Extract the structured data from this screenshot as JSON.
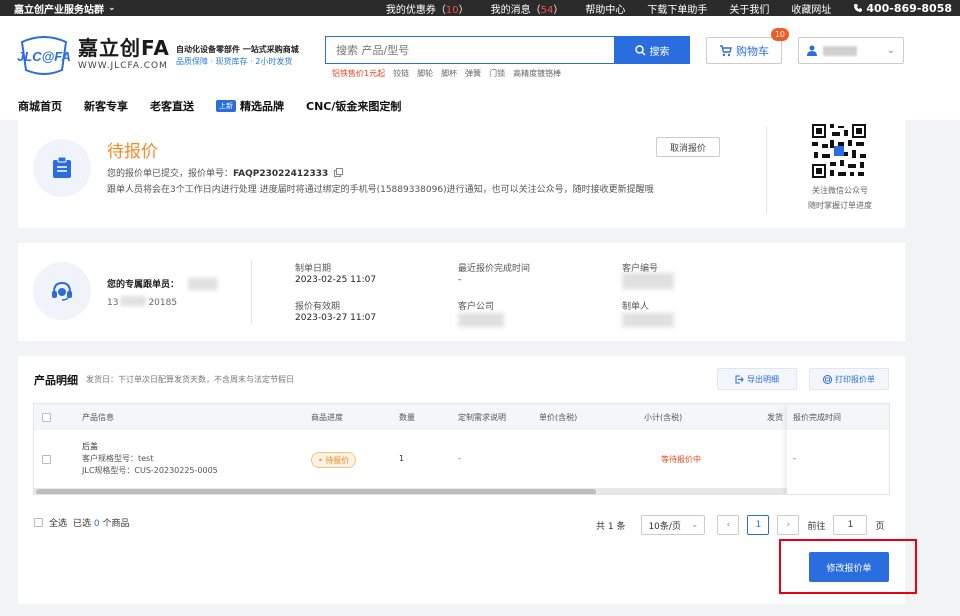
{
  "topbar": {
    "site_name": "嘉立创产业服务站群",
    "coupon_label": "我的优惠券（",
    "coupon_count": "10",
    "message_label": "我的消息（",
    "message_count": "54",
    "close_paren": "）",
    "help": "帮助中心",
    "download": "下载下单助手",
    "about": "关于我们",
    "favorite": "收藏网址",
    "phone": "400-869-8058"
  },
  "header": {
    "logo_text": "JLC@FA",
    "brand_name": "嘉立创FA",
    "brand_url": "WWW.JLCFA.COM",
    "slogan_1": "自动化设备零部件 一站式采购商城",
    "slogan_2": "品质保障 · 现货库存 · 2小时发货",
    "search_placeholder": "搜索 产品/型号",
    "search_button": "搜索",
    "hotwords": [
      "铝铁售价1元起",
      "铰链",
      "脚轮",
      "脚杯",
      "弹簧",
      "门锁",
      "高精度镀铬棒"
    ],
    "cart_label": "购物车",
    "cart_badge": "10"
  },
  "nav": {
    "items": [
      "商城首页",
      "新客专享",
      "老客直送",
      "精选品牌",
      "CNC/钣金来图定制"
    ],
    "new_tag": "上新"
  },
  "status_panel": {
    "title": "待报价",
    "line1_prefix": "您的报价单已提交，报价单号：",
    "quote_no": "FAQP23022412333",
    "line2": "跟单人员将会在3个工作日内进行处理 进度届时将通过绑定的手机号(15889338096)进行通知，也可以关注公众号，随时接收更新提醒哦",
    "cancel_button": "取消报价",
    "qr_caption_1": "关注微信公众号",
    "qr_caption_2": "随时掌握订单进度"
  },
  "info_panel": {
    "manager_label": "您的专属跟单员：",
    "manager_phone_prefix": "13",
    "manager_phone_suffix": "20185",
    "order_date_label": "制单日期",
    "order_date": "2023-02-25 11:07",
    "valid_until_label": "报价有效期",
    "valid_until": "2023-03-27 11:07",
    "last_quote_label": "最近报价完成时间",
    "last_quote_value": "-",
    "customer_company_label": "客户公司",
    "customer_no_label": "客户编号",
    "maker_label": "制单人"
  },
  "products": {
    "title": "产品明细",
    "subtitle": "发货日：下订单次日配算发货天数，不含周末与法定节假日",
    "export_button": "导出明细",
    "print_button": "打印报价单",
    "columns": [
      "产品信息",
      "商品进度",
      "数量",
      "定制需求说明",
      "单价(含税)",
      "小计(含税)",
      "发货",
      "报价完成时间"
    ],
    "rows": [
      {
        "name": "后盖",
        "customer_model": "客户规格型号：test",
        "jlc_model": "JLC规格型号：CUS-20230225-0005",
        "status": "• 待报价",
        "qty": "1",
        "custom_req": "-",
        "subtotal": "等待报价中",
        "finish_time": "-"
      }
    ],
    "select_all": "全选",
    "selected_prefix": "已选",
    "selected_count": "0",
    "selected_suffix": "个商品",
    "total": "共 1 条",
    "page_size": "10条/页",
    "current_page": "1",
    "goto_label": "前往",
    "goto_value": "1",
    "page_unit": "页",
    "modify_button": "修改报价单"
  }
}
